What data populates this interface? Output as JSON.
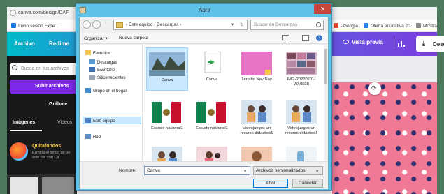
{
  "browser": {
    "url": "canva.com/design/DAF",
    "bookmarks": [
      {
        "label": "Inicio sesión Expe...",
        "color": "#1a73e8"
      },
      {
        "label": "- Google...",
        "color": "#ea4335"
      },
      {
        "label": "Oferta educativa 20...",
        "color": "#2a7de1"
      },
      {
        "label": "Mostra",
        "color": "#888888"
      }
    ]
  },
  "canva": {
    "menu_archivo": "Archivo",
    "menu_redimensionar": "Redime",
    "vista_previa": "Vista previa",
    "descargar": "Desca",
    "search_placeholder": "Busca en tus archivos",
    "subir": "Subir archivos",
    "grabate": "Grábate",
    "tab_imagenes": "Imágenes",
    "tab_videos": "Videos",
    "quitafondos_title": "Quitafondos",
    "quitafondos_desc": "Elimina el fondo de un solo clic con Ca"
  },
  "dialog": {
    "title": "Abrir",
    "close": "✕",
    "back": "←",
    "forward": "→",
    "up": "↑",
    "path": [
      "Este equipo",
      "Descargas"
    ],
    "path_sep": "›",
    "refresh": "↻",
    "search_placeholder": "Buscar en Descargas",
    "organizar": "Organizar ▾",
    "nueva_carpeta": "Nueva carpeta",
    "help": "?",
    "nav": [
      {
        "label": "Favoritos",
        "color": "#f2c94c",
        "indent": 0
      },
      {
        "label": "Descargas",
        "color": "#5a9bd5",
        "indent": 1
      },
      {
        "label": "Escritorio",
        "color": "#3b6fb6",
        "indent": 1
      },
      {
        "label": "Sitios recientes",
        "color": "#9aa7b5",
        "indent": 1
      },
      {
        "label": "Grupo en el hogar",
        "color": "#3c8fd6",
        "indent": 0
      },
      {
        "label": "Este equipo",
        "color": "#4a7fc1",
        "indent": 0
      },
      {
        "label": "Red",
        "color": "#5e8fc8",
        "indent": 0
      }
    ],
    "files": [
      {
        "name": "Canva",
        "kind": "landscape",
        "selected": true
      },
      {
        "name": "Canva",
        "kind": "shortcut"
      },
      {
        "name": "1er año Nay Nay",
        "kind": "pink"
      },
      {
        "name": "IMG-20220201-WA0028",
        "kind": "collage"
      },
      {
        "name": "Escudo nacional1",
        "kind": "flag"
      },
      {
        "name": "Escudo nacional1",
        "kind": "flag"
      },
      {
        "name": "Videojuegos un recurso didactico1",
        "kind": "people"
      },
      {
        "name": "Videojuegos un recurso didactico1",
        "kind": "people"
      },
      {
        "name": "",
        "kind": "people"
      },
      {
        "name": "",
        "kind": "people2"
      },
      {
        "name": "",
        "kind": "peach"
      },
      {
        "name": "",
        "kind": "blue"
      }
    ],
    "nombre_label": "Nombre:",
    "nombre_value": "Canva",
    "tipo_value": "Archivos personalizados",
    "abrir": "Abrir",
    "cancelar": "Cancelar"
  }
}
